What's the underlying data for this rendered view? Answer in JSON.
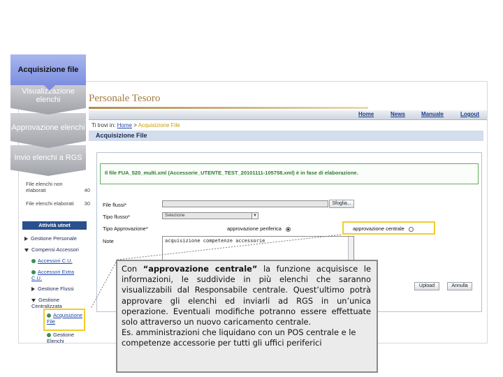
{
  "workflow": [
    {
      "label": "Acquisizione file"
    },
    {
      "label": "Visualizzazione elenchi"
    },
    {
      "label": "Approvazione elenchi"
    },
    {
      "label": "Invio elenchi a RGS"
    }
  ],
  "app": {
    "logo": "Personale Tesoro",
    "nav": [
      "Home",
      "News",
      "Manuale",
      "Logout"
    ],
    "breadcrumb": {
      "prefix": "Ti trovi in:",
      "home": "Home",
      "sep": ">",
      "current": "Acquisizione File"
    },
    "page_title": "Acquisizione File",
    "sidebar": {
      "stats": [
        {
          "label": "File elenchi non elaborati",
          "value": "40"
        },
        {
          "label": "File elenchi elaborati",
          "value": "30"
        }
      ],
      "header": "Attività utnet",
      "items": [
        {
          "label": "Gestione Personale",
          "level": 1
        },
        {
          "label": "Compensi Accessori",
          "level": 1
        },
        {
          "label": "Accessori C.U.",
          "level": 2
        },
        {
          "label": "Accessori Extra C.U.",
          "level": 2
        },
        {
          "label": "Gestione Flussi",
          "level": 2
        },
        {
          "label": "Gestione Centralizzata",
          "level": 2
        },
        {
          "label": "Acquisizione File",
          "level": 3
        },
        {
          "label": "Gestione Elenchi",
          "level": 3
        }
      ]
    },
    "message": "Il file FUA_520_multi.xml (Accessorie_UTENTE_TEST_20101111-105758.xml) è in fase di elaborazione.",
    "form": {
      "file_label": "File flussi*",
      "browse_button": "Sfoglia...",
      "type_label": "Tipo flusso*",
      "type_value": "Selezione",
      "approval_label": "Tipo Approvazione*",
      "radio_periferica": "approvazione periferica",
      "radio_centrale": "approvazione centrale",
      "note_label": "Note",
      "note_value": "acquisizione competenze accessorie",
      "upload_button": "Upload",
      "cancel_button": "Annulla"
    }
  },
  "callout": {
    "paragraph1_prefix": "Con ",
    "paragraph1_bold": "“approvazione centrale”",
    "paragraph1_rest": " la funzione acquisisce le informazioni, le suddivide in più elenchi che saranno visualizzabili dal Responsabile centrale. Quest’ultimo potrà approvare gli elenchi ed inviarli ad RGS in un’unica operazione. Eventuali modifiche potranno essere effettuate solo attraverso un nuovo caricamento centrale.",
    "paragraph2": "Es. amministrazioni che liquidano con un POS centrale e le competenze accessorie per tutti gli uffici periferici"
  },
  "colors": {
    "highlight": "#f1cc2c",
    "accent_blue": "#284f8e",
    "success_green": "#2e7b2e",
    "logo_gold": "#a27a3e"
  }
}
